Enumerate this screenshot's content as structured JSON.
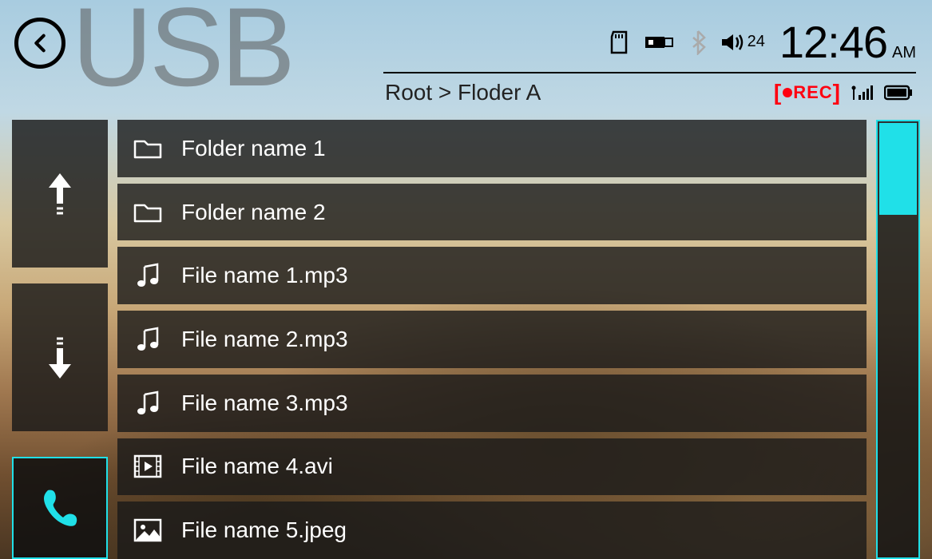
{
  "header": {
    "title": "USB",
    "breadcrumb": "Root > Floder A"
  },
  "status": {
    "volume": "24",
    "time": "12:46",
    "ampm": "AM",
    "rec_label": "REC"
  },
  "files": [
    {
      "type": "folder",
      "name": "Folder name 1"
    },
    {
      "type": "folder",
      "name": "Folder name 2"
    },
    {
      "type": "music",
      "name": "File name 1.mp3"
    },
    {
      "type": "music",
      "name": "File name 2.mp3"
    },
    {
      "type": "music",
      "name": "File name 3.mp3"
    },
    {
      "type": "video",
      "name": "File name 4.avi"
    },
    {
      "type": "image",
      "name": "File name 5.jpeg"
    }
  ],
  "colors": {
    "accent": "#20e0e8",
    "rec": "#ff0010"
  }
}
